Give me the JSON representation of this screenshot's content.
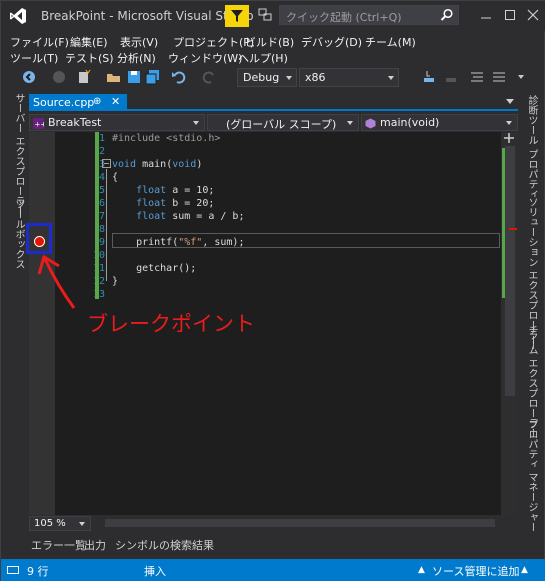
{
  "window": {
    "title": "BreakPoint - Microsoft Visual Studio",
    "quick_launch_placeholder": "クイック起動 (Ctrl+Q)"
  },
  "menu": {
    "row1": [
      "ファイル(F)",
      "編集(E)",
      "表示(V)",
      "プロジェクト(P)",
      "ビルド(B)",
      "デバッグ(D)",
      "チーム(M)"
    ],
    "row2": [
      "ツール(T)",
      "テスト(S)",
      "分析(N)",
      "ウィンドウ(W)",
      "ヘルプ(H)"
    ]
  },
  "toolbar": {
    "config": "Debug",
    "platform": "x86"
  },
  "left_tabs": [
    "サーバー エクスプローラー",
    "ツールボックス"
  ],
  "right_tabs": [
    "診断ツール",
    "プロパティ",
    "ソリューション エクスプローラー",
    "チーム エクスプローラー",
    "プロパティ マネージャー"
  ],
  "doc_tab": {
    "name": "Source.cpp",
    "pin": "⊕",
    "close": "✕"
  },
  "navbar": {
    "project": "BreakTest",
    "scope": "(グローバル スコープ)",
    "member": "main(void)"
  },
  "editor": {
    "line_numbers": [
      "1",
      "2",
      "3",
      "4",
      "5",
      "6",
      "7",
      "8",
      "9",
      "10",
      "11",
      "12",
      "13"
    ],
    "breakpoint_line": 9
  },
  "zoom": "105 %",
  "bottom_tabs": [
    "エラー一覧",
    "出力",
    "シンボルの検索結果"
  ],
  "status": {
    "line": "9 行",
    "mode": "挿入",
    "source_control": "ソース管理に追加"
  },
  "annotation": {
    "label": "ブレークポイント"
  },
  "colors": {
    "accent": "#007acc",
    "breakpoint": "#e51400",
    "annotation_red": "#ea1c1c",
    "annotation_blue": "#1a2ccf"
  }
}
